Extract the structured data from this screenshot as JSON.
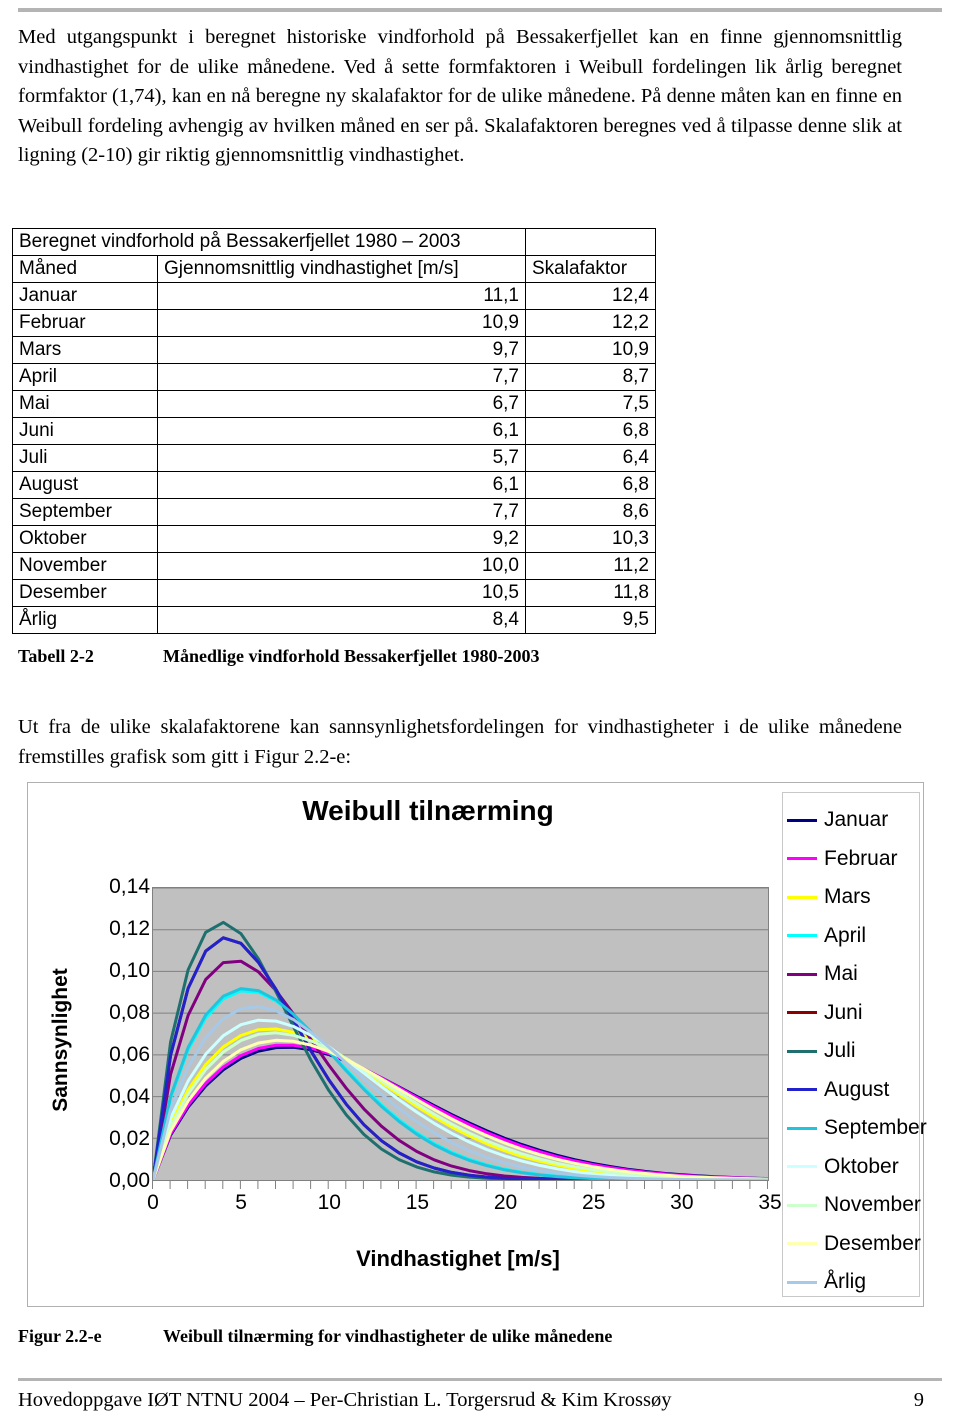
{
  "document": {
    "paragraph_1": "Med utgangspunkt i beregnet historiske vindforhold på Bessakerfjellet kan en finne gjennomsnittlig vindhastighet for de ulike månedene. Ved å sette formfaktoren i Weibull fordelingen lik årlig beregnet formfaktor (1,74), kan en nå beregne ny skalafaktor for de ulike månedene. På denne måten kan en finne en Weibull fordeling avhengig av hvilken måned en ser på. Skalafaktoren beregnes ved å tilpasse denne slik at ligning (2-10) gir riktig gjennomsnittlig vindhastighet.",
    "paragraph_2": "Ut fra de ulike skalafaktorene kan sannsynlighetsfordelingen for vindhastigheter i de ulike månedene fremstilles grafisk som gitt i Figur 2.2-e:",
    "footer_text": "Hovedoppgave IØT NTNU 2004 – Per-Christian L. Torgersrud & Kim Krossøy",
    "page_number": "9"
  },
  "table": {
    "title": "Beregnet vindforhold på Bessakerfjellet 1980 – 2003",
    "headers": [
      "Måned",
      "Gjennomsnittlig vindhastighet [m/s]",
      "Skalafaktor"
    ],
    "rows": [
      {
        "month": "Januar",
        "speed": "11,1",
        "scale": "12,4"
      },
      {
        "month": "Februar",
        "speed": "10,9",
        "scale": "12,2"
      },
      {
        "month": "Mars",
        "speed": "9,7",
        "scale": "10,9"
      },
      {
        "month": "April",
        "speed": "7,7",
        "scale": "8,7"
      },
      {
        "month": "Mai",
        "speed": "6,7",
        "scale": "7,5"
      },
      {
        "month": "Juni",
        "speed": "6,1",
        "scale": "6,8"
      },
      {
        "month": "Juli",
        "speed": "5,7",
        "scale": "6,4"
      },
      {
        "month": "August",
        "speed": "6,1",
        "scale": "6,8"
      },
      {
        "month": "September",
        "speed": "7,7",
        "scale": "8,6"
      },
      {
        "month": "Oktober",
        "speed": "9,2",
        "scale": "10,3"
      },
      {
        "month": "November",
        "speed": "10,0",
        "scale": "11,2"
      },
      {
        "month": "Desember",
        "speed": "10,5",
        "scale": "11,8"
      },
      {
        "month": "Årlig",
        "speed": "8,4",
        "scale": "9,5"
      }
    ],
    "caption_label": "Tabell 2-2",
    "caption_text": "Månedlige vindforhold Bessakerfjellet 1980-2003"
  },
  "figure": {
    "caption_label": "Figur 2.2-e",
    "caption_text": "Weibull tilnærming for vindhastigheter de ulike månedene"
  },
  "chart_data": {
    "type": "line",
    "title": "Weibull tilnærming",
    "xlabel": "Vindhastighet [m/s]",
    "ylabel": "Sannsynlighet",
    "xlim": [
      0,
      35
    ],
    "ylim": [
      0,
      0.14
    ],
    "xticks": [
      "0",
      "5",
      "10",
      "15",
      "20",
      "25",
      "30",
      "35"
    ],
    "yticks": [
      "0,00",
      "0,02",
      "0,04",
      "0,06",
      "0,08",
      "0,10",
      "0,12",
      "0,14"
    ],
    "grid": "horizontal",
    "legend_position": "right",
    "shape_factor": 1.74,
    "plot_background": "#c0c0c0",
    "series": [
      {
        "name": "Januar",
        "scale": 12.4,
        "color": "#000080",
        "peak_y": 0.063
      },
      {
        "name": "Februar",
        "scale": 12.2,
        "color": "#ff00ff",
        "peak_y": 0.064
      },
      {
        "name": "Mars",
        "scale": 10.9,
        "color": "#ffff00",
        "peak_y": 0.072
      },
      {
        "name": "April",
        "scale": 8.7,
        "color": "#00ffff",
        "peak_y": 0.09
      },
      {
        "name": "Mai",
        "scale": 7.5,
        "color": "#800080",
        "peak_y": 0.104
      },
      {
        "name": "Juni",
        "scale": 6.8,
        "color": "#8b0000",
        "peak_y": 0.115
      },
      {
        "name": "Juli",
        "scale": 6.4,
        "color": "#1f6f6f",
        "peak_y": 0.123
      },
      {
        "name": "August",
        "scale": 6.8,
        "color": "#2222cc",
        "peak_y": 0.115
      },
      {
        "name": "September",
        "scale": 8.6,
        "color": "#21c4dd",
        "peak_y": 0.091
      },
      {
        "name": "Oktober",
        "scale": 10.3,
        "color": "#ccffff",
        "peak_y": 0.076
      },
      {
        "name": "November",
        "scale": 11.2,
        "color": "#ccffcc",
        "peak_y": 0.07
      },
      {
        "name": "Desember",
        "scale": 11.8,
        "color": "#ffffb0",
        "peak_y": 0.066
      },
      {
        "name": "Årlig",
        "scale": 9.5,
        "color": "#a6c9e8",
        "peak_y": 0.082
      }
    ]
  }
}
